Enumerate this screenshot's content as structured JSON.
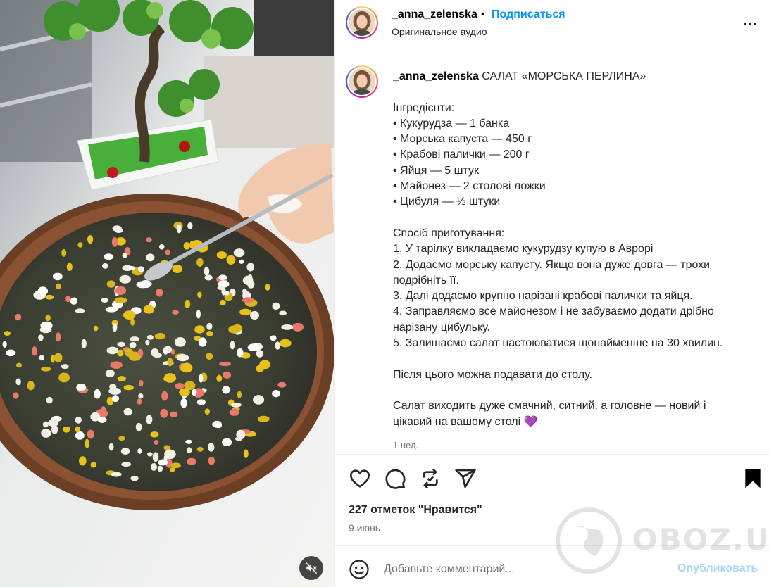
{
  "post": {
    "username": "_anna_zelenska",
    "separator": "•",
    "follow_label": "Подписаться",
    "audio_label": "Оригинальное аудио"
  },
  "caption": {
    "username": "_anna_zelenska",
    "text": " САЛАТ «МОРСЬКА ПЕРЛИНА»\n\nІнгредієнти:\n• Кукурудза — 1 банка\n• Морська капуста — 450 г\n• Крабові палички — 200 г\n• Яйця — 5 штук\n• Майонез — 2 столові ложки\n• Цибуля — ½ штуки\n\nСпосіб приготування:\n1. У тарілку викладаємо кукурудзу купую в Аврорі\n2. Додаємо морську капусту. Якщо вона дуже довга — трохи\nподрібніть її.\n3. Далі додаємо крупно нарізані крабові палички та яйця.\n4. Заправляємо все майонезом і не забуваємо додати дрібно\nнарізану цибульку.\n5. Залишаємо салат настоюватися щонайменше на 30 хвилин.\n\nПісля цього можна подавати до столу.\n\nСалат виходить дуже смачний, ситний, а головне — новий і\nцікавий на вашому столі 💜",
    "time_ago": "1 нед."
  },
  "engagement": {
    "likes": "227 отметок \"Нравится\"",
    "date": "9 июнь"
  },
  "comment": {
    "placeholder": "Добавьте комментарий...",
    "publish_label": "Опубликовать"
  },
  "watermark": {
    "text": "OBOZ.UA"
  },
  "icons": {
    "like": "heart-icon",
    "comment": "comment-bubble-icon",
    "repost": "repost-icon",
    "share": "paper-plane-icon",
    "save": "bookmark-filled-icon",
    "more": "more-dots-icon",
    "emoji": "smiley-icon",
    "mute": "speaker-muted-icon"
  },
  "colors": {
    "link": "#0095f6",
    "publish_disabled": "#aad4f8",
    "secondary_text": "#737373"
  }
}
